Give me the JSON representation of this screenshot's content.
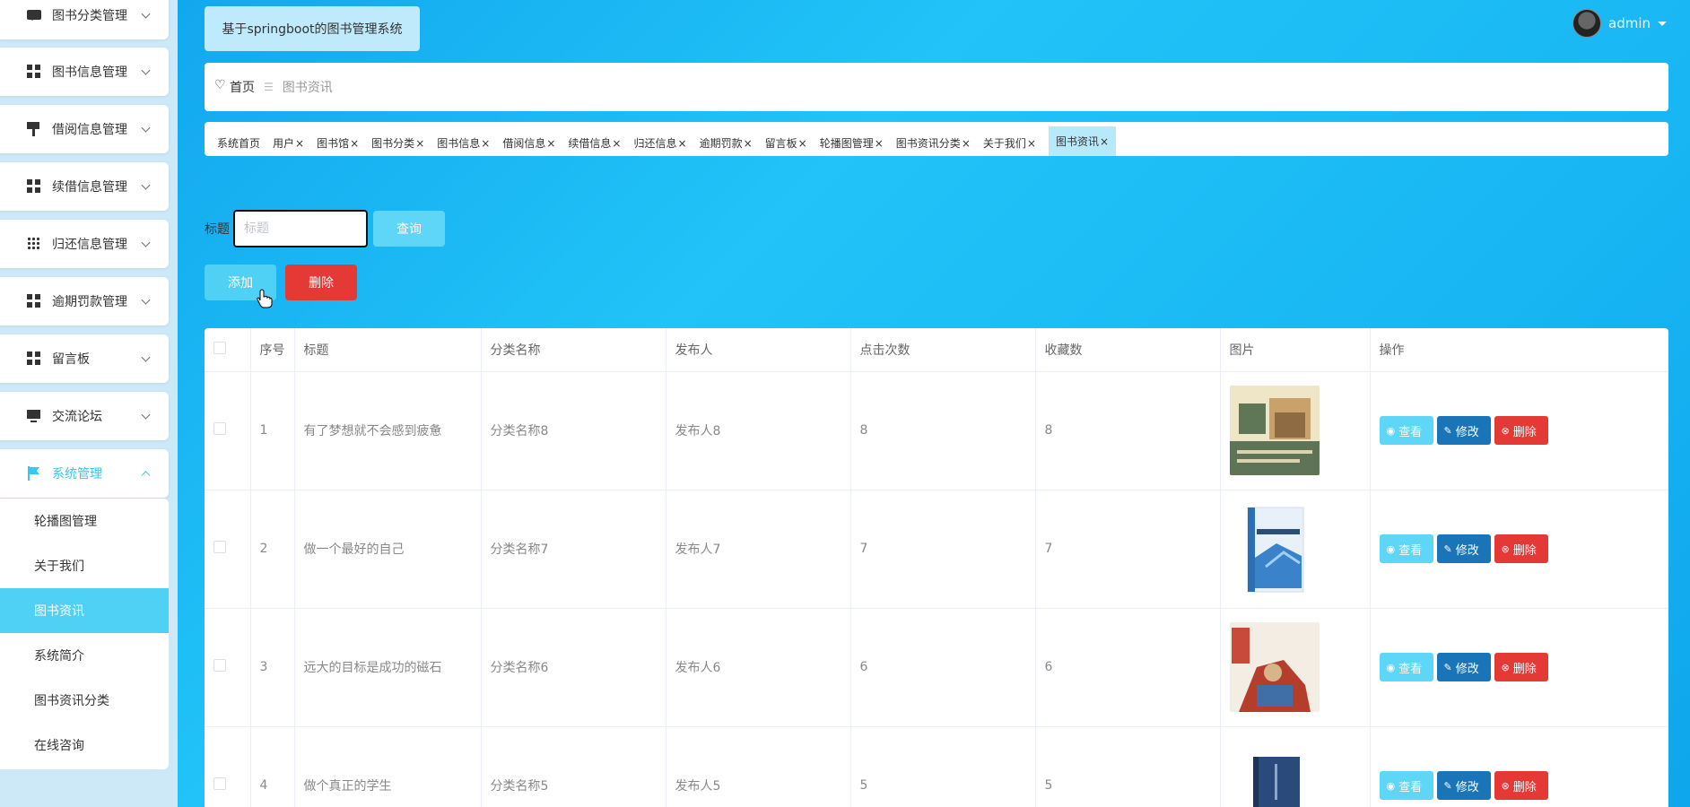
{
  "app_title": "基于springboot的图书管理系统",
  "user": {
    "name": "admin"
  },
  "sidebar": {
    "items": [
      {
        "label": "图书分类管理",
        "icon": "chat-icon"
      },
      {
        "label": "图书信息管理",
        "icon": "grid-icon"
      },
      {
        "label": "借阅信息管理",
        "icon": "brush-icon"
      },
      {
        "label": "续借信息管理",
        "icon": "grid-icon"
      },
      {
        "label": "归还信息管理",
        "icon": "apps-icon"
      },
      {
        "label": "逾期罚款管理",
        "icon": "grid-icon"
      },
      {
        "label": "留言板",
        "icon": "grid-icon"
      },
      {
        "label": "交流论坛",
        "icon": "monitor-icon"
      },
      {
        "label": "系统管理",
        "icon": "flag-icon"
      }
    ],
    "submenu": [
      {
        "label": "轮播图管理"
      },
      {
        "label": "关于我们"
      },
      {
        "label": "图书资讯"
      },
      {
        "label": "系统简介"
      },
      {
        "label": "图书资讯分类"
      },
      {
        "label": "在线咨询"
      }
    ]
  },
  "breadcrumb": {
    "home": "首页",
    "current": "图书资讯"
  },
  "tags": [
    "系统首页",
    "用户",
    "图书馆",
    "图书分类",
    "图书信息",
    "借阅信息",
    "续借信息",
    "归还信息",
    "逾期罚款",
    "留言板",
    "轮播图管理",
    "图书资讯分类",
    "关于我们",
    "图书资讯"
  ],
  "search": {
    "label": "标题",
    "placeholder": "标题",
    "query_label": "查询"
  },
  "actions": {
    "add_label": "添加",
    "delete_label": "删除"
  },
  "table": {
    "headers": [
      "序号",
      "标题",
      "分类名称",
      "发布人",
      "点击次数",
      "收藏数",
      "图片",
      "操作"
    ],
    "rows": [
      {
        "index": "1",
        "title": "有了梦想就不会感到疲惫",
        "category": "分类名称8",
        "publisher": "发布人8",
        "clicks": "8",
        "favorites": "8"
      },
      {
        "index": "2",
        "title": "做一个最好的自己",
        "category": "分类名称7",
        "publisher": "发布人7",
        "clicks": "7",
        "favorites": "7"
      },
      {
        "index": "3",
        "title": "远大的目标是成功的磁石",
        "category": "分类名称6",
        "publisher": "发布人6",
        "clicks": "6",
        "favorites": "6"
      },
      {
        "index": "4",
        "title": "做个真正的学生",
        "category": "分类名称5",
        "publisher": "发布人5",
        "clicks": "5",
        "favorites": "5"
      }
    ],
    "op_labels": {
      "view": "查看",
      "edit": "修改",
      "delete": "删除"
    }
  },
  "colors": {
    "accent": "#4fd0f5",
    "danger": "#e53935",
    "edit": "#1a75b8"
  }
}
